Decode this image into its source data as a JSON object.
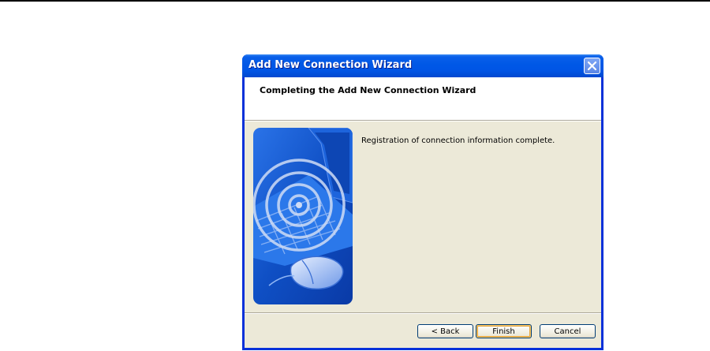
{
  "window": {
    "title": "Add New Connection Wizard"
  },
  "header": {
    "title": "Completing the Add New Connection Wizard"
  },
  "body": {
    "message": "Registration of connection information complete."
  },
  "buttons": {
    "back": "< Back",
    "finish": "Finish",
    "cancel": "Cancel"
  },
  "colors": {
    "titlebar": "#0055e5",
    "dialog_face": "#ece9d8",
    "art_blue": "#1e5fd6"
  },
  "icons": {
    "close": "close-icon",
    "art": "wireless-keyboard-mouse-illustration"
  }
}
